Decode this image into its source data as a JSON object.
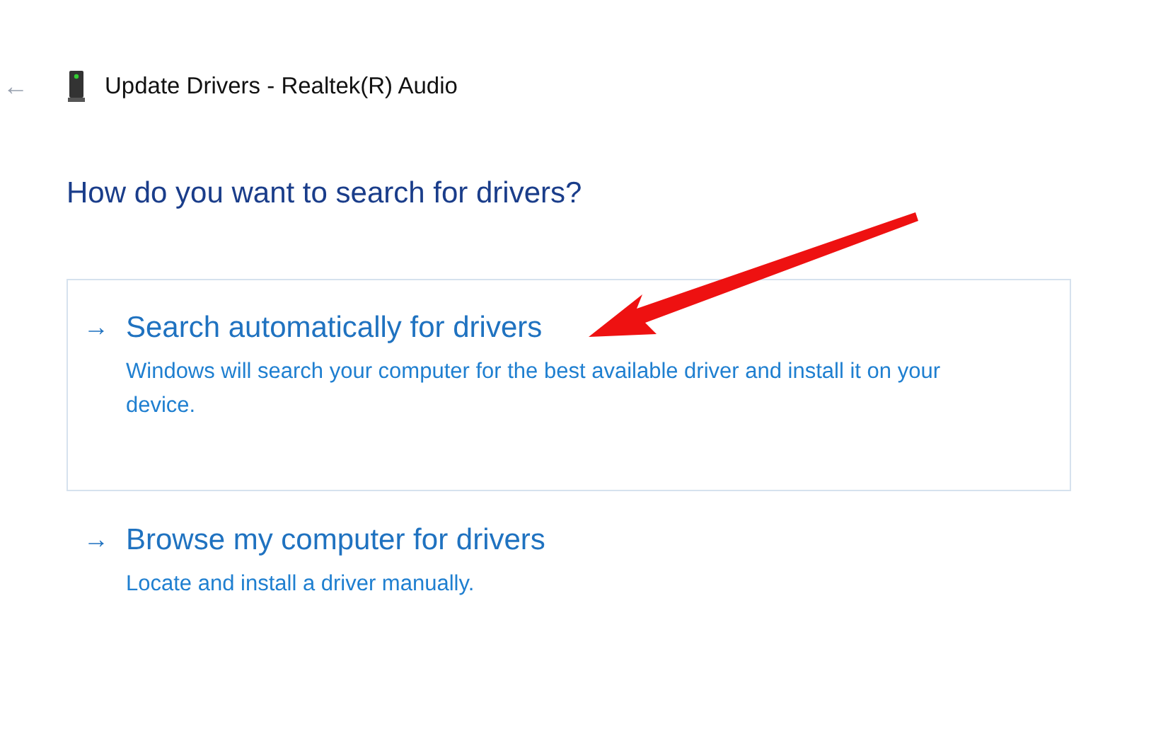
{
  "window": {
    "back": "←",
    "title": "Update Drivers - Realtek(R) Audio"
  },
  "heading": "How do you want to search for drivers?",
  "options": [
    {
      "arrow": "→",
      "title": "Search automatically for drivers",
      "description": "Windows will search your computer for the best available driver and install it on your device.",
      "selected": true
    },
    {
      "arrow": "→",
      "title": "Browse my computer for drivers",
      "description": "Locate and install a driver manually.",
      "selected": false
    }
  ]
}
